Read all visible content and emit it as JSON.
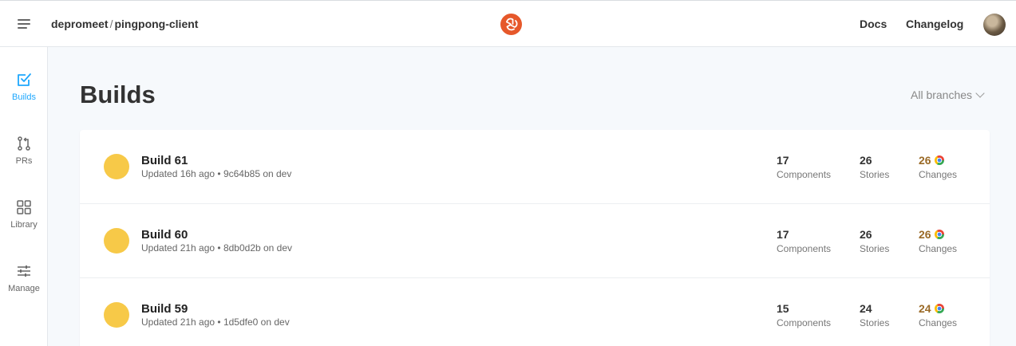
{
  "header": {
    "org": "depromeet",
    "separator": "/",
    "repo": "pingpong-client",
    "links": [
      "Docs",
      "Changelog"
    ]
  },
  "sidebar": {
    "items": [
      {
        "label": "Builds",
        "icon": "checkbox-icon",
        "active": true
      },
      {
        "label": "PRs",
        "icon": "pull-request-icon",
        "active": false
      },
      {
        "label": "Library",
        "icon": "grid-icon",
        "active": false
      },
      {
        "label": "Manage",
        "icon": "sliders-icon",
        "active": false
      }
    ]
  },
  "page": {
    "title": "Builds",
    "branch_filter": "All branches"
  },
  "builds": [
    {
      "name": "Build 61",
      "meta": "Updated 16h ago • 9c64b85 on dev",
      "components": "17",
      "components_label": "Components",
      "stories": "26",
      "stories_label": "Stories",
      "changes": "26",
      "changes_label": "Changes",
      "status_color": "#f7c948"
    },
    {
      "name": "Build 60",
      "meta": "Updated 21h ago • 8db0d2b on dev",
      "components": "17",
      "components_label": "Components",
      "stories": "26",
      "stories_label": "Stories",
      "changes": "26",
      "changes_label": "Changes",
      "status_color": "#f7c948"
    },
    {
      "name": "Build 59",
      "meta": "Updated 21h ago • 1d5dfe0 on dev",
      "components": "15",
      "components_label": "Components",
      "stories": "24",
      "stories_label": "Stories",
      "changes": "24",
      "changes_label": "Changes",
      "status_color": "#f7c948"
    }
  ],
  "colors": {
    "accent": "#1ea7fd",
    "logo": "#e6582a",
    "pending": "#f7c948"
  }
}
